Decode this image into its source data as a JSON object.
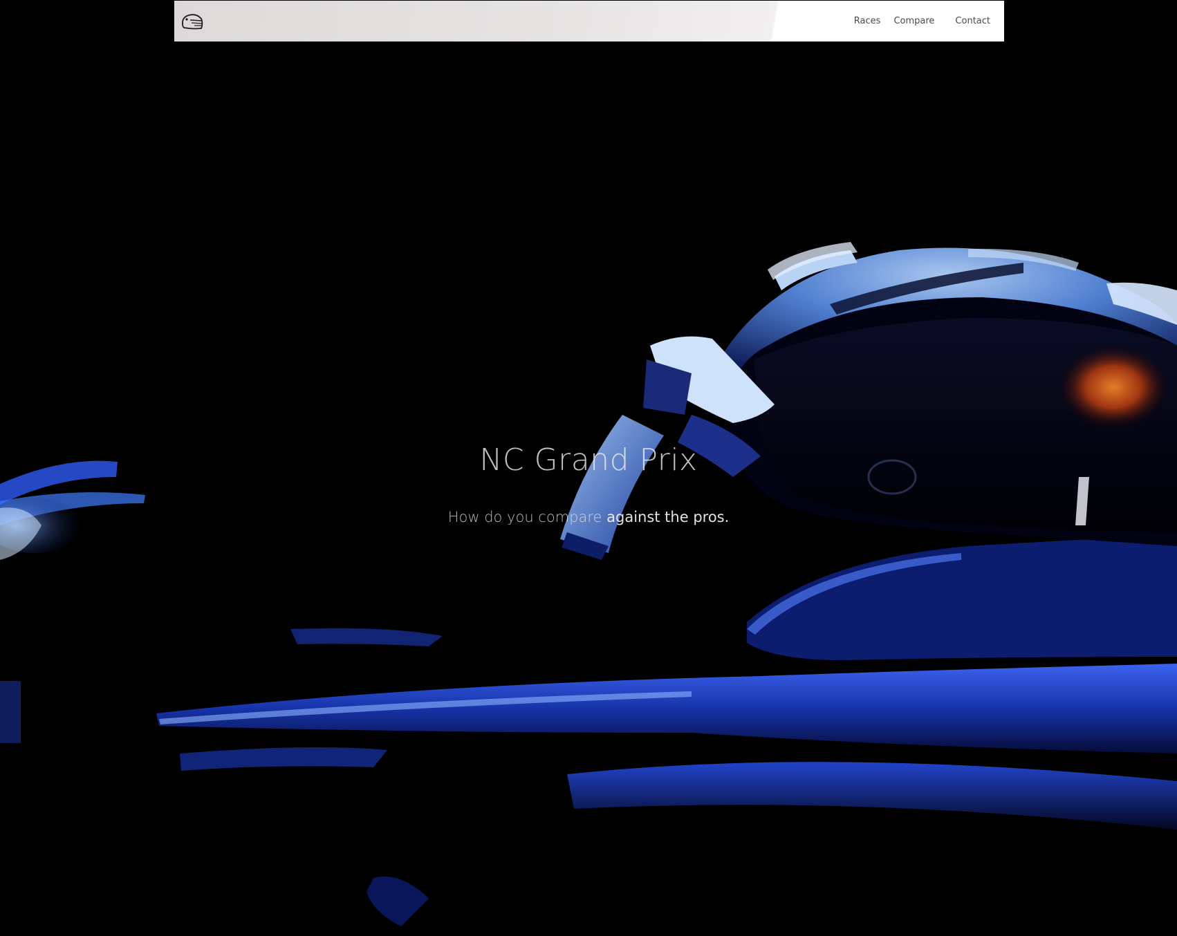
{
  "nav": {
    "logo_icon": "helmet-icon",
    "links": [
      {
        "label": "Races"
      },
      {
        "label": "Compare"
      },
      {
        "label": "Contact"
      }
    ]
  },
  "hero": {
    "title": "NC Grand Prix",
    "subtitle_lead": "How do you compare ",
    "subtitle_emphasis": "against the pros.",
    "background_image": "race-driver-helmet-in-car-photo"
  },
  "colors": {
    "background": "#000000",
    "nav_bar": "#e8e5e5",
    "nav_text": "#4a4a4a",
    "hero_text": "#e6e6ea",
    "accent_blue": "#1f3fd8"
  }
}
